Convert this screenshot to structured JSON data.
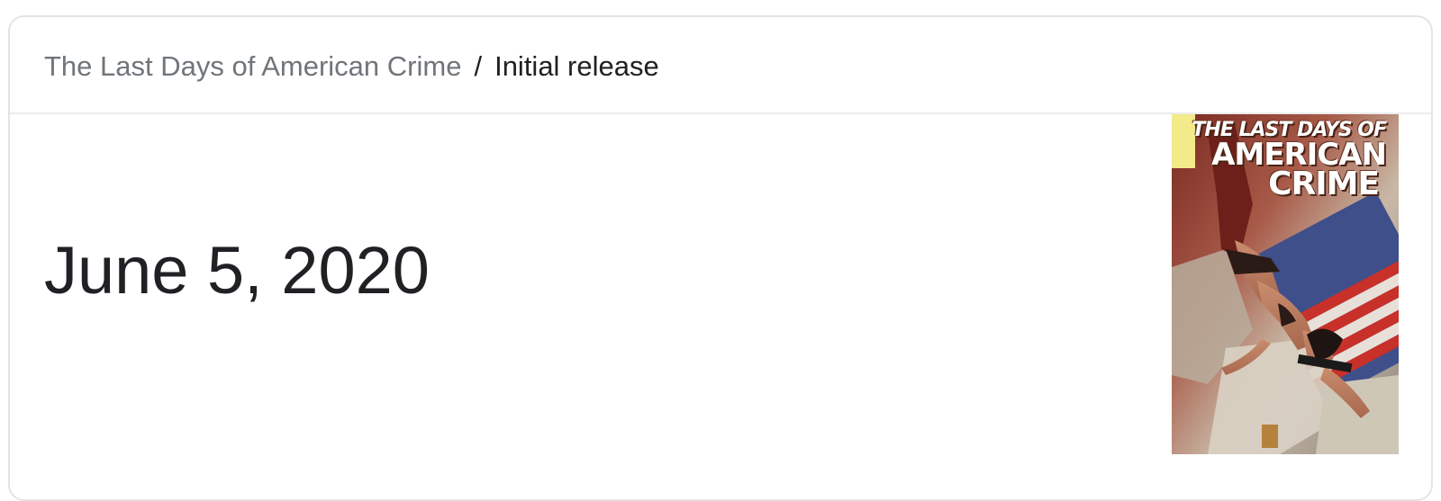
{
  "breadcrumb": {
    "parent": "The Last Days of American Crime",
    "separator": "/",
    "current": "Initial release"
  },
  "answer": {
    "value": "June 5, 2020"
  },
  "thumbnail": {
    "title_line1": "THE LAST DAYS OF",
    "title_line2": "AMERICAN",
    "title_line3": "CRIME"
  }
}
